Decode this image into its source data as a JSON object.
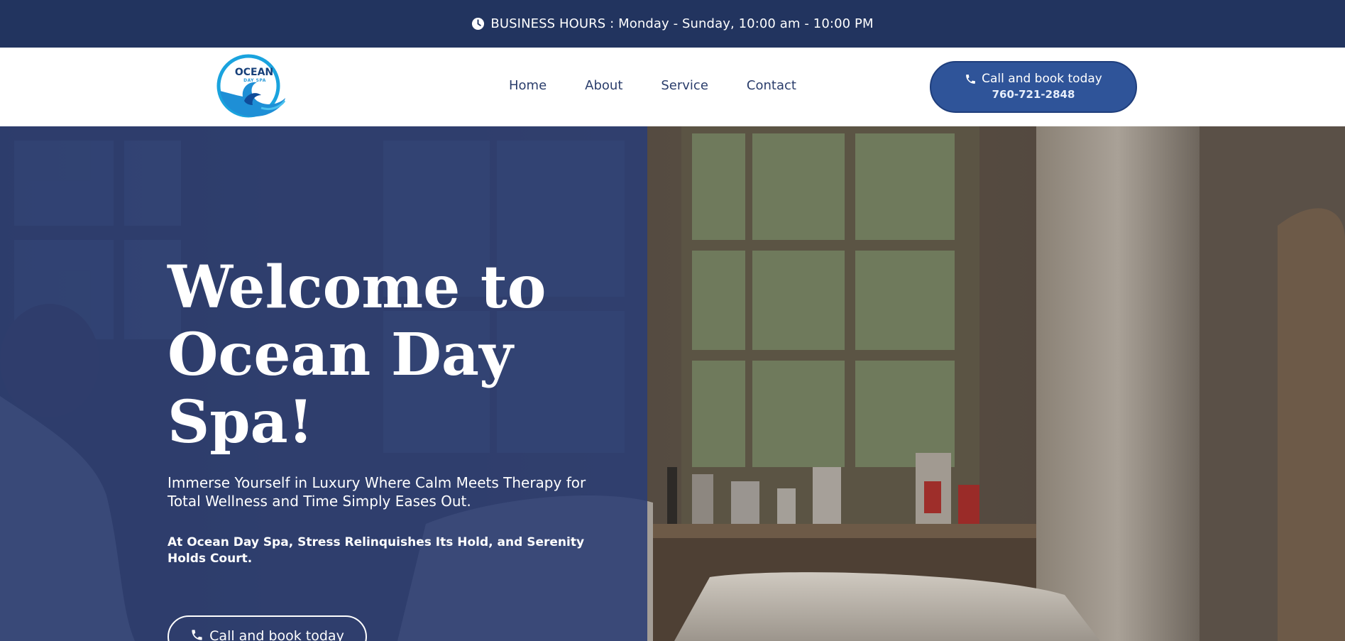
{
  "topbar": {
    "icon": "clock-icon",
    "text": "BUSINESS HOURS : Monday - Sunday, 10:00 am - 10:00 PM"
  },
  "header": {
    "logo": {
      "title": "OCEAN",
      "subtitle": "DAY SPA"
    },
    "nav": [
      {
        "label": "Home"
      },
      {
        "label": "About"
      },
      {
        "label": "Service"
      },
      {
        "label": "Contact"
      }
    ],
    "cta": {
      "icon": "phone-icon",
      "label": "Call and book today",
      "phone": "760-721-2848"
    }
  },
  "hero": {
    "title": "Welcome to Ocean Day Spa!",
    "subtitle": "Immerse Yourself in Luxury Where Calm Meets Therapy for Total Wellness and Time Simply Eases Out.",
    "tagline": "At Ocean Day Spa, Stress Relinquishes Its Hold, and Serenity Holds Court.",
    "cta": {
      "icon": "phone-icon",
      "label": "Call and book today"
    }
  },
  "colors": {
    "topbar": "#22345f",
    "overlay": "#2b3e74",
    "button": "#2f5499",
    "nav_text": "#2a3d6b"
  }
}
